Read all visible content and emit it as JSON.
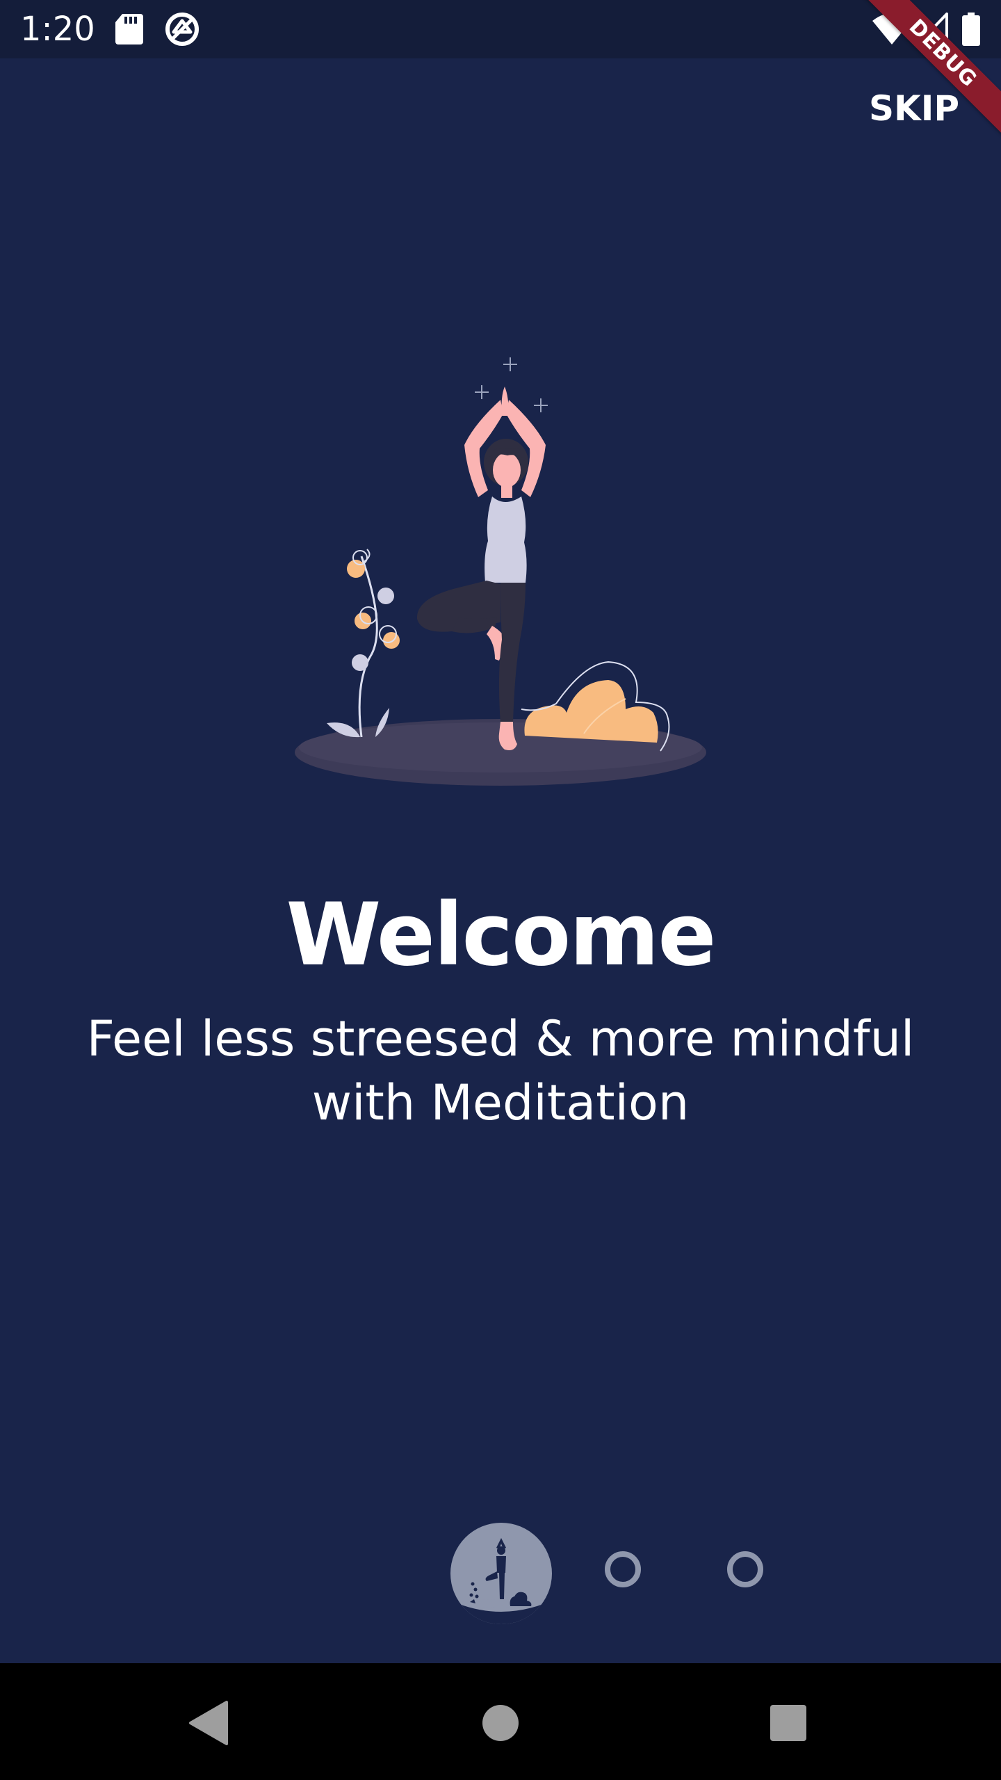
{
  "status_bar": {
    "time": "1:20",
    "icons": [
      "sd-card-icon",
      "sync-icon",
      "wifi-icon",
      "cellular-signal-icon",
      "battery-icon"
    ]
  },
  "debug_banner": {
    "label": "DEBUG",
    "color": "#8a1c2c"
  },
  "header": {
    "skip_label": "SKIP"
  },
  "onboarding": {
    "illustration": "yoga-woman-illustration",
    "title": "Welcome",
    "subtitle_line1": "Feel less streesed & more mindful",
    "subtitle_line2": "with Meditation"
  },
  "page_indicator": {
    "current_page": 1,
    "total_pages": 3,
    "active_icon": "yoga-thumbnail-icon"
  },
  "nav_bar": {
    "buttons": [
      "back-icon",
      "home-icon",
      "recents-icon"
    ]
  },
  "colors": {
    "background": "#19244a",
    "status_bar": "#141d3a",
    "indicator": "#8f97ad",
    "accent_orange": "#f8bb80",
    "text": "#ffffff"
  }
}
